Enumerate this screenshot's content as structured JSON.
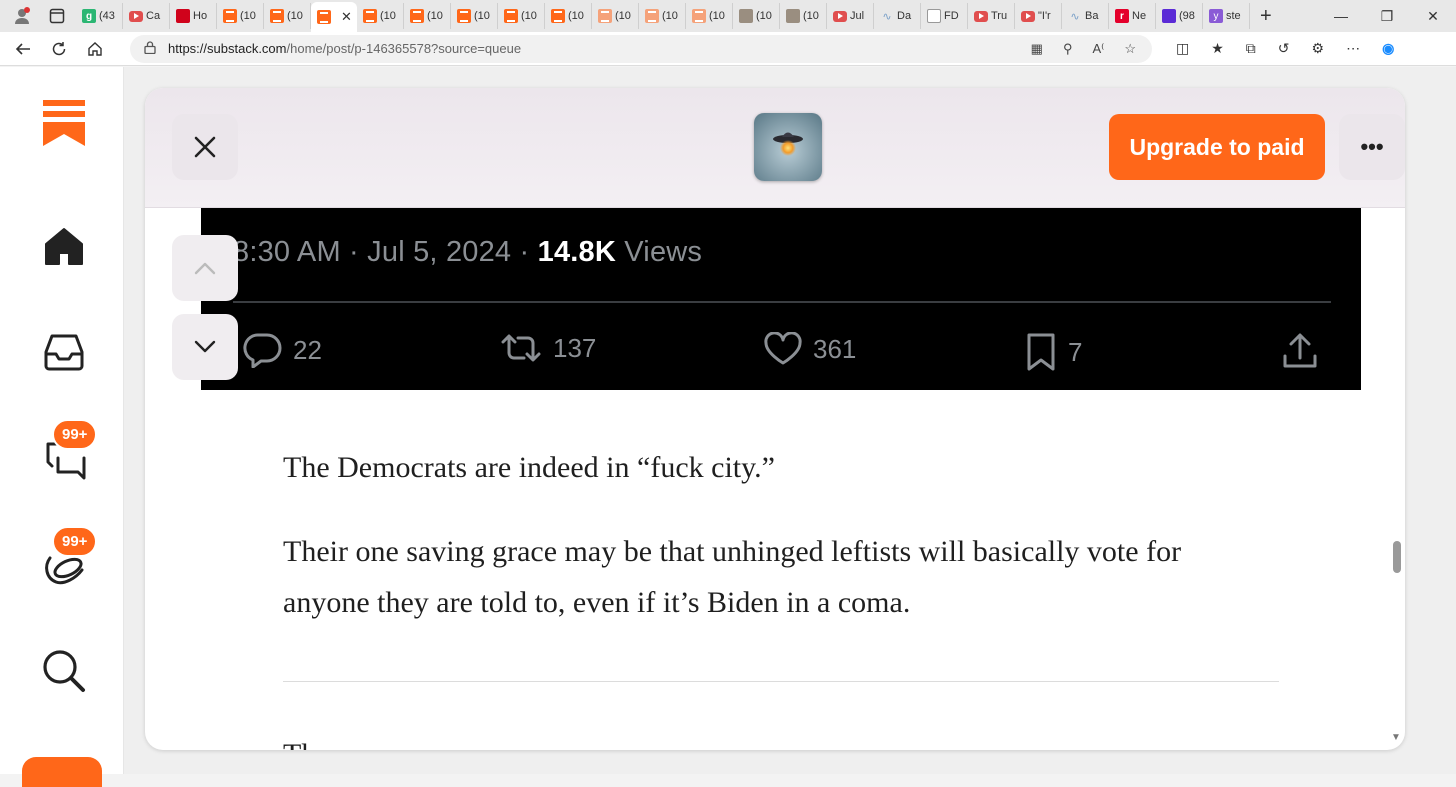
{
  "browser": {
    "tabs": [
      {
        "icon": "green-g",
        "label": "(43"
      },
      {
        "icon": "youtube",
        "label": "Ca"
      },
      {
        "icon": "red-mic",
        "label": "Ho"
      },
      {
        "icon": "substack",
        "label": "(10"
      },
      {
        "icon": "substack",
        "label": "(10"
      },
      {
        "icon": "substack",
        "label": "",
        "active": true
      },
      {
        "icon": "substack",
        "label": "(10"
      },
      {
        "icon": "substack",
        "label": "(10"
      },
      {
        "icon": "substack",
        "label": "(10"
      },
      {
        "icon": "substack",
        "label": "(10"
      },
      {
        "icon": "substack",
        "label": "(10"
      },
      {
        "icon": "substack-faded",
        "label": "(10"
      },
      {
        "icon": "substack-faded",
        "label": "(10"
      },
      {
        "icon": "substack-faded",
        "label": "(10"
      },
      {
        "icon": "photo",
        "label": "(10"
      },
      {
        "icon": "photo",
        "label": "(10"
      },
      {
        "icon": "youtube",
        "label": "Jul"
      },
      {
        "icon": "wave",
        "label": "Da"
      },
      {
        "icon": "doc",
        "label": "FD"
      },
      {
        "icon": "youtube",
        "label": "Tru"
      },
      {
        "icon": "youtube",
        "label": "\"I'r"
      },
      {
        "icon": "wave",
        "label": "Ba"
      },
      {
        "icon": "r-red",
        "label": "Ne"
      },
      {
        "icon": "mail",
        "label": "(98"
      },
      {
        "icon": "y-purple",
        "label": "ste"
      }
    ],
    "url_host": "https://substack.com",
    "url_rest": "/home/post/p-146365578?source=queue"
  },
  "rail": {
    "chat_badge": "99+",
    "activity_badge": "99+"
  },
  "modal": {
    "upgrade_label": "Upgrade to paid",
    "more_label": "•••"
  },
  "tweet": {
    "time": "8:30 AM · Jul 5, 2024 · ",
    "views_count": "14.8K",
    "views_label": " Views",
    "replies": "22",
    "retweets": "137",
    "likes": "361",
    "bookmarks": "7"
  },
  "article": {
    "p1": "The Democrats are indeed in “fuck city.”",
    "p2": "Their one saving grace may be that unhinged leftists will basically vote for anyone they are told to, even if it’s Biden in a coma.",
    "cutoff": "The ... ... ... ..."
  },
  "colors": {
    "accent": "#ff6719",
    "tweet_bg": "#000000",
    "tweet_muted": "#8b8f94"
  }
}
